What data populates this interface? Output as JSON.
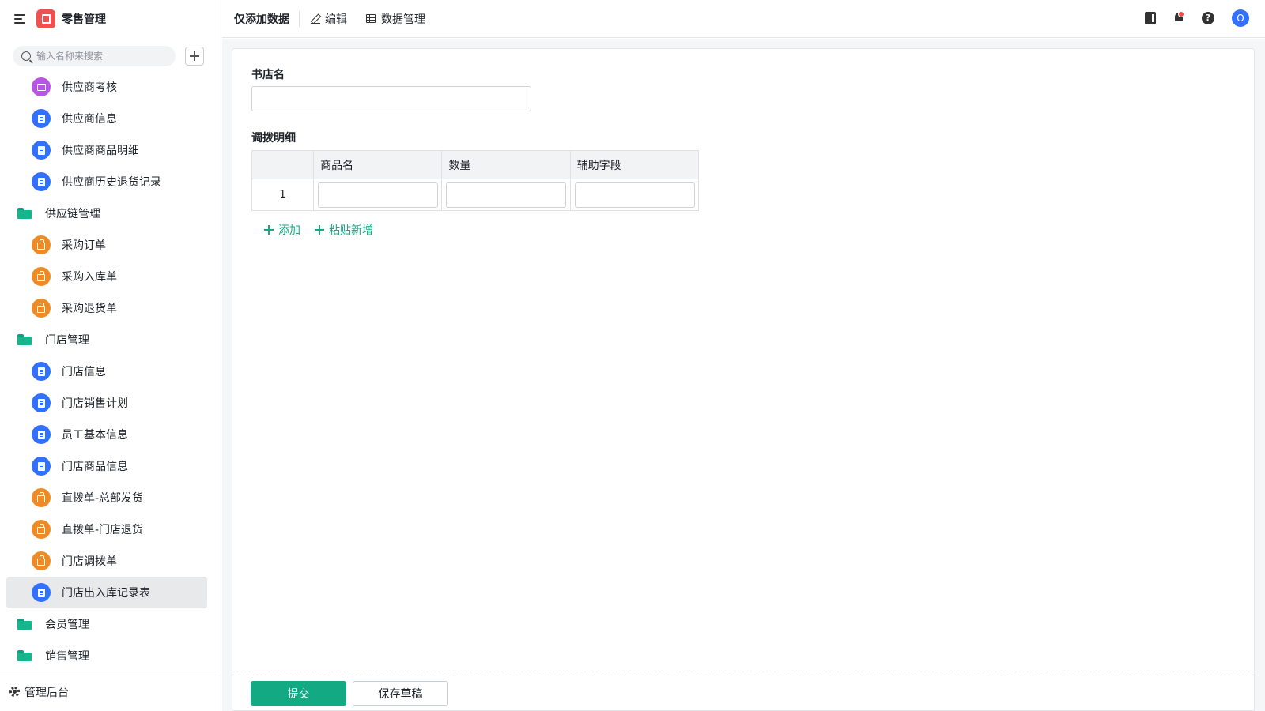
{
  "app": {
    "title": "零售管理"
  },
  "search": {
    "placeholder": "输入名称来搜索"
  },
  "sidebar": {
    "items": [
      {
        "label": "供应商考核",
        "type": "child",
        "icon": "chart-icon",
        "color": "purple"
      },
      {
        "label": "供应商信息",
        "type": "child",
        "icon": "document-icon",
        "color": "blue"
      },
      {
        "label": "供应商商品明细",
        "type": "child",
        "icon": "document-icon",
        "color": "blue"
      },
      {
        "label": "供应商历史退货记录",
        "type": "child",
        "icon": "document-icon",
        "color": "blue"
      },
      {
        "label": "供应链管理",
        "type": "folder",
        "icon": "folder-icon"
      },
      {
        "label": "采购订单",
        "type": "child",
        "icon": "bag-icon",
        "color": "orange"
      },
      {
        "label": "采购入库单",
        "type": "child",
        "icon": "bag-icon",
        "color": "orange"
      },
      {
        "label": "采购退货单",
        "type": "child",
        "icon": "bag-icon",
        "color": "orange"
      },
      {
        "label": "门店管理",
        "type": "folder",
        "icon": "folder-icon"
      },
      {
        "label": "门店信息",
        "type": "child",
        "icon": "document-icon",
        "color": "blue"
      },
      {
        "label": "门店销售计划",
        "type": "child",
        "icon": "document-icon",
        "color": "blue"
      },
      {
        "label": "员工基本信息",
        "type": "child",
        "icon": "document-icon",
        "color": "blue"
      },
      {
        "label": "门店商品信息",
        "type": "child",
        "icon": "document-icon",
        "color": "blue"
      },
      {
        "label": "直拨单-总部发货",
        "type": "child",
        "icon": "bag-icon",
        "color": "orange"
      },
      {
        "label": "直拨单-门店退货",
        "type": "child",
        "icon": "bag-icon",
        "color": "orange"
      },
      {
        "label": "门店调拨单",
        "type": "child",
        "icon": "bag-icon",
        "color": "orange"
      },
      {
        "label": "门店出入库记录表",
        "type": "child",
        "icon": "document-icon",
        "color": "blue",
        "active": true
      },
      {
        "label": "会员管理",
        "type": "folder",
        "icon": "folder-icon"
      },
      {
        "label": "销售管理",
        "type": "folder",
        "icon": "folder-icon"
      }
    ],
    "footer_label": "管理后台"
  },
  "topbar": {
    "view_title": "仅添加数据",
    "edit_label": "编辑",
    "data_manage_label": "数据管理",
    "avatar_letter": "O",
    "help_glyph": "?"
  },
  "form": {
    "store_name_label": "书店名",
    "store_name_value": "",
    "details_label": "调拨明细",
    "table": {
      "columns": [
        "",
        "商品名",
        "数量",
        "辅助字段"
      ],
      "rows": [
        {
          "index": "1",
          "values": [
            "",
            "",
            ""
          ]
        }
      ]
    },
    "add_label": "添加",
    "paste_add_label": "粘贴新增",
    "submit_label": "提交",
    "save_draft_label": "保存草稿"
  },
  "colors": {
    "primary": "#13a982",
    "brand_logo": "#f0504f",
    "icon_blue": "#3370ff",
    "icon_orange": "#f08a25",
    "icon_purple": "#b855e6",
    "folder_green": "#16b58d"
  }
}
